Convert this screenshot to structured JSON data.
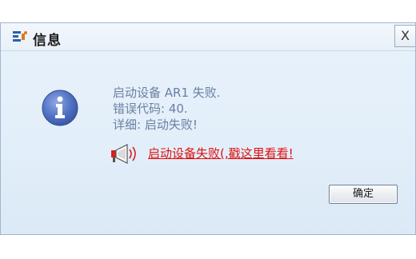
{
  "dialog": {
    "title": "信息",
    "close_label": "X",
    "message_lines": [
      "启动设备 AR1 失败.",
      "错误代码: 40.",
      "详细: 启动失败!"
    ],
    "warning_link": "启动设备失败(,戳这里看看!",
    "ok_label": "确定"
  },
  "colors": {
    "message_text": "#6a7fa3",
    "warning_text": "#e01010",
    "info_icon": "#4a6fc0"
  },
  "icons": {
    "app": "app-logo-icon",
    "info": "info-icon",
    "warning": "megaphone-icon"
  }
}
